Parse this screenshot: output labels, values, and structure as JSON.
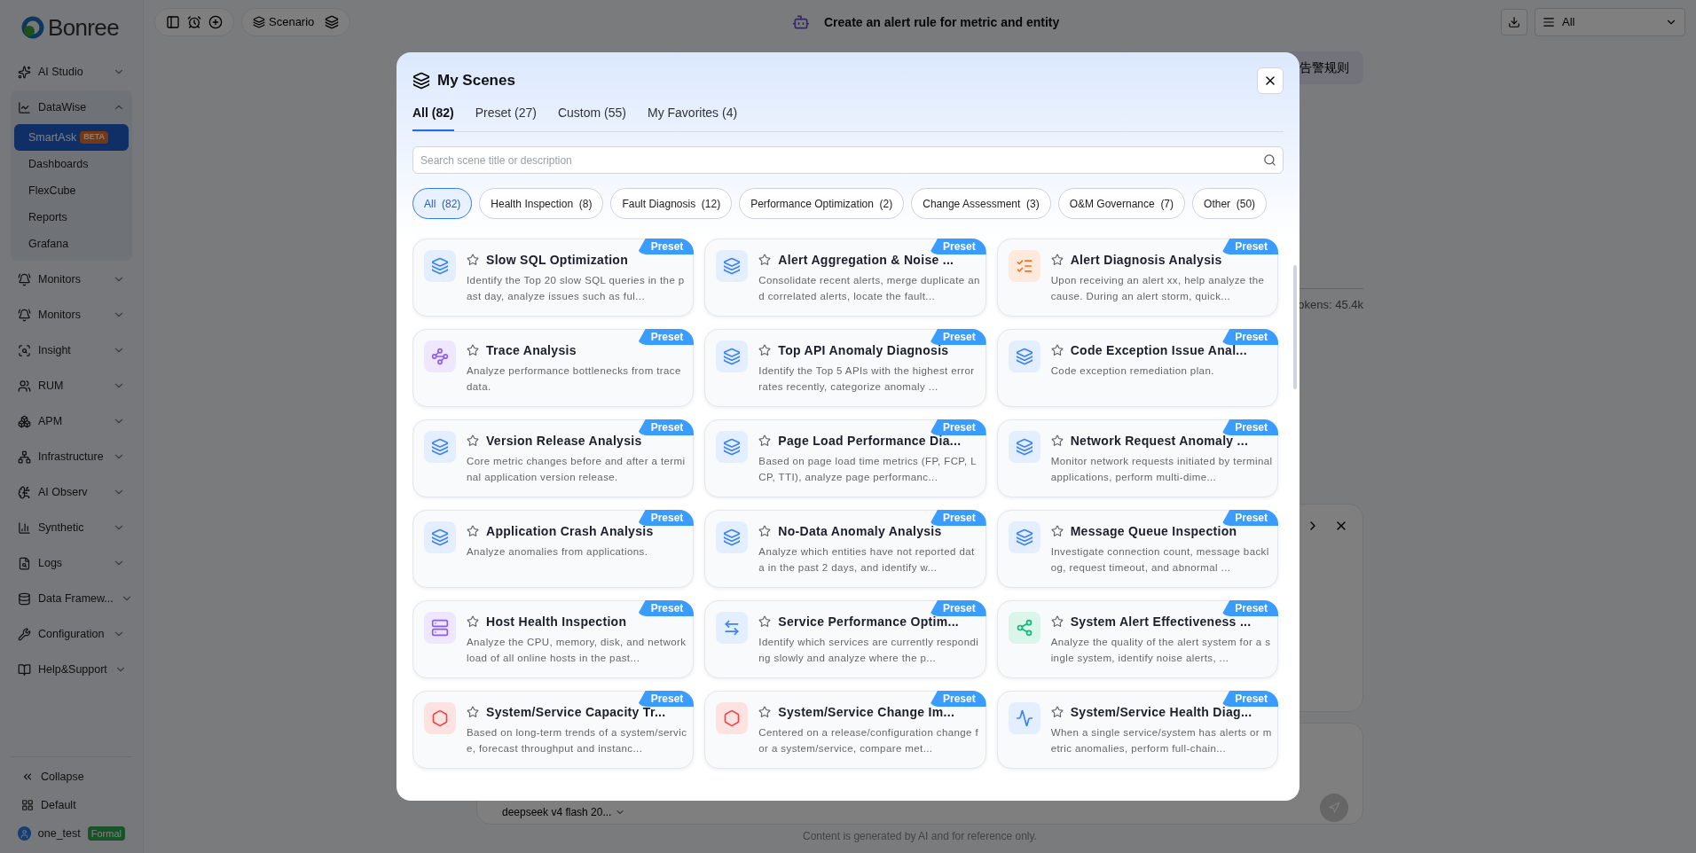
{
  "sidebar": {
    "logo": "Bonree",
    "items": [
      {
        "label": "AI Studio",
        "expanded": false
      },
      {
        "label": "DataWise",
        "expanded": true,
        "children": [
          {
            "label": "SmartAsk",
            "badge": "BETA",
            "selected": true
          },
          {
            "label": "Dashboards",
            "selected": false
          },
          {
            "label": "FlexCube",
            "selected": false
          },
          {
            "label": "Reports",
            "selected": false
          },
          {
            "label": "Grafana",
            "selected": false
          }
        ]
      },
      {
        "label": "Monitors",
        "expanded": false
      },
      {
        "label": "Monitors",
        "expanded": false
      },
      {
        "label": "Insight",
        "expanded": false
      },
      {
        "label": "RUM",
        "expanded": false
      },
      {
        "label": "APM",
        "expanded": false
      },
      {
        "label": "Infrastructure",
        "expanded": false
      },
      {
        "label": "AI Observ",
        "expanded": false
      },
      {
        "label": "Synthetic",
        "expanded": false
      },
      {
        "label": "Logs",
        "expanded": false
      },
      {
        "label": "Data Framew...",
        "expanded": false
      },
      {
        "label": "Configuration",
        "expanded": false
      },
      {
        "label": "Help&Support",
        "expanded": false
      }
    ],
    "footer": {
      "collapse": "Collapse",
      "workspace": "Default",
      "user": "one_test",
      "user_badge": "Formal"
    }
  },
  "toolbar": {
    "scenario_button": "Scenario",
    "title": "Create an alert rule for metric and entity",
    "filter": "All"
  },
  "chat": {
    "prompt_chip": "告警规则",
    "tokens": "okens: 45.4k",
    "model": "deepseek v4 flash 20...",
    "disclaimer": "Content is generated by AI and for reference only."
  },
  "modal": {
    "title": "My Scenes",
    "tabs": [
      {
        "label": "All (82)",
        "selected": true
      },
      {
        "label": "Preset (27)",
        "selected": false
      },
      {
        "label": "Custom (55)",
        "selected": false
      },
      {
        "label": "My Favorites (4)",
        "selected": false
      }
    ],
    "search": {
      "placeholder": "Search scene title or description"
    },
    "filters": [
      {
        "label": "All",
        "count": "(82)",
        "selected": true
      },
      {
        "label": "Health Inspection",
        "count": "(8)",
        "selected": false
      },
      {
        "label": "Fault Diagnosis",
        "count": "(12)",
        "selected": false
      },
      {
        "label": "Performance Optimization",
        "count": "(2)",
        "selected": false
      },
      {
        "label": "Change Assessment",
        "count": "(3)",
        "selected": false
      },
      {
        "label": "O&M Governance",
        "count": "(7)",
        "selected": false
      },
      {
        "label": "Other",
        "count": "(50)",
        "selected": false
      }
    ],
    "cards": [
      {
        "kind": "layers",
        "title": "Slow SQL Optimization",
        "description": "Identify the Top 20 slow SQL queries in the past day, analyze issues such as ful...",
        "badge": "Preset",
        "favorite": false
      },
      {
        "kind": "layers",
        "title": "Alert Aggregation & Noise ...",
        "description": "Consolidate recent alerts, merge duplicate and correlated alerts, locate the fault...",
        "badge": "Preset",
        "favorite": false
      },
      {
        "kind": "checklist",
        "title": "Alert Diagnosis Analysis",
        "description": "Upon receiving an alert xx, help analyze the cause. During an alert storm, quick...",
        "badge": "Preset",
        "favorite": false
      },
      {
        "kind": "trace",
        "title": "Trace Analysis",
        "description": "Analyze performance bottlenecks from trace data.",
        "badge": "Preset",
        "favorite": false
      },
      {
        "kind": "layers",
        "title": "Top API Anomaly Diagnosis",
        "description": "Identify the Top 5 APIs with the highest error rates recently, categorize anomaly ...",
        "badge": "Preset",
        "favorite": false
      },
      {
        "kind": "layers",
        "title": "Code Exception Issue Anal...",
        "description": "Code exception remediation plan.",
        "badge": "Preset",
        "favorite": false
      },
      {
        "kind": "layers",
        "title": "Version Release Analysis",
        "description": "Core metric changes before and after a terminal application version release.",
        "badge": "Preset",
        "favorite": false
      },
      {
        "kind": "layers",
        "title": "Page Load Performance Dia...",
        "description": "Based on page load time metrics (FP, FCP, LCP, TTI), analyze page performanc...",
        "badge": "Preset",
        "favorite": false
      },
      {
        "kind": "layers",
        "title": "Network Request Anomaly ...",
        "description": "Monitor network requests initiated by terminal applications, perform multi-dime...",
        "badge": "Preset",
        "favorite": false
      },
      {
        "kind": "layers",
        "title": "Application Crash Analysis",
        "description": "Analyze anomalies from applications.",
        "badge": "Preset",
        "favorite": false
      },
      {
        "kind": "layers",
        "title": "No-Data Anomaly Analysis",
        "description": "Analyze which entities have not reported data in the past 2 days, and identify w...",
        "badge": "Preset",
        "favorite": false
      },
      {
        "kind": "layers",
        "title": "Message Queue Inspection",
        "description": "Investigate connection count, message backlog, request timeout, and abnormal ...",
        "badge": "Preset",
        "favorite": false
      },
      {
        "kind": "server",
        "title": "Host Health Inspection",
        "description": "Analyze the CPU, memory, disk, and network load of all online hosts in the past...",
        "badge": "Preset",
        "favorite": false
      },
      {
        "kind": "swap",
        "title": "Service Performance Optim...",
        "description": "Identify which services are currently responding slowly and analyze where the p...",
        "badge": "Preset",
        "favorite": false
      },
      {
        "kind": "network",
        "title": "System Alert Effectiveness ...",
        "description": "Analyze the quality of the alert system for a single system, identify noise alerts, ...",
        "badge": "Preset",
        "favorite": false
      },
      {
        "kind": "capacity",
        "title": "System/Service Capacity Tr...",
        "description": "Based on long-term trends of a system/service, forecast throughput and instanc...",
        "badge": "Preset",
        "favorite": false
      },
      {
        "kind": "capacity",
        "title": "System/Service Change Im...",
        "description": "Centered on a release/configuration change for a system/service, compare met...",
        "badge": "Preset",
        "favorite": false
      },
      {
        "kind": "pulse",
        "title": "System/Service Health Diag...",
        "description": "When a single service/system has alerts or metric anomalies, perform full-chain...",
        "badge": "Preset",
        "favorite": false
      }
    ]
  }
}
